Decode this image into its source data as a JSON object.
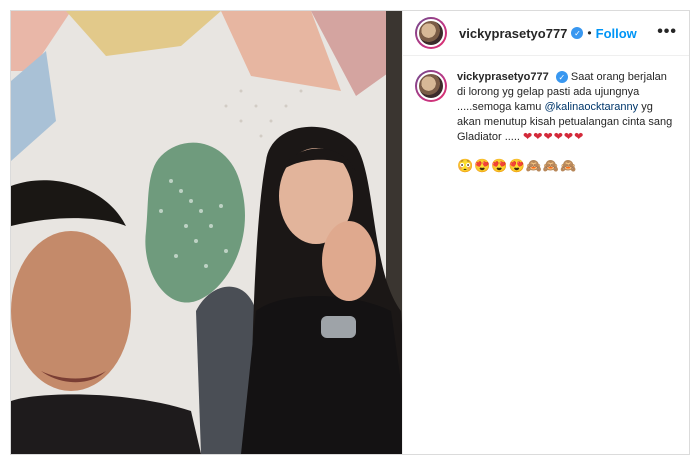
{
  "post": {
    "username": "vickyprasetyo777",
    "follow_label": "Follow",
    "separator": "•",
    "more_label": "•••",
    "caption": {
      "username": "vickyprasetyo777",
      "text_part1": "Saat orang berjalan di lorong yg gelap pasti ada ujungnya .....semoga kamu",
      "mention": "@kalinaocktaranny",
      "text_part2": "yg akan menutup kisah petualangan cinta sang Gladiator .....",
      "hearts": "❤❤❤❤❤❤",
      "emojis": "😳😍😍😍🙈🙈🙈"
    }
  },
  "colors": {
    "follow": "#0095f6",
    "verified": "#3897f0",
    "mention": "#00376b"
  }
}
